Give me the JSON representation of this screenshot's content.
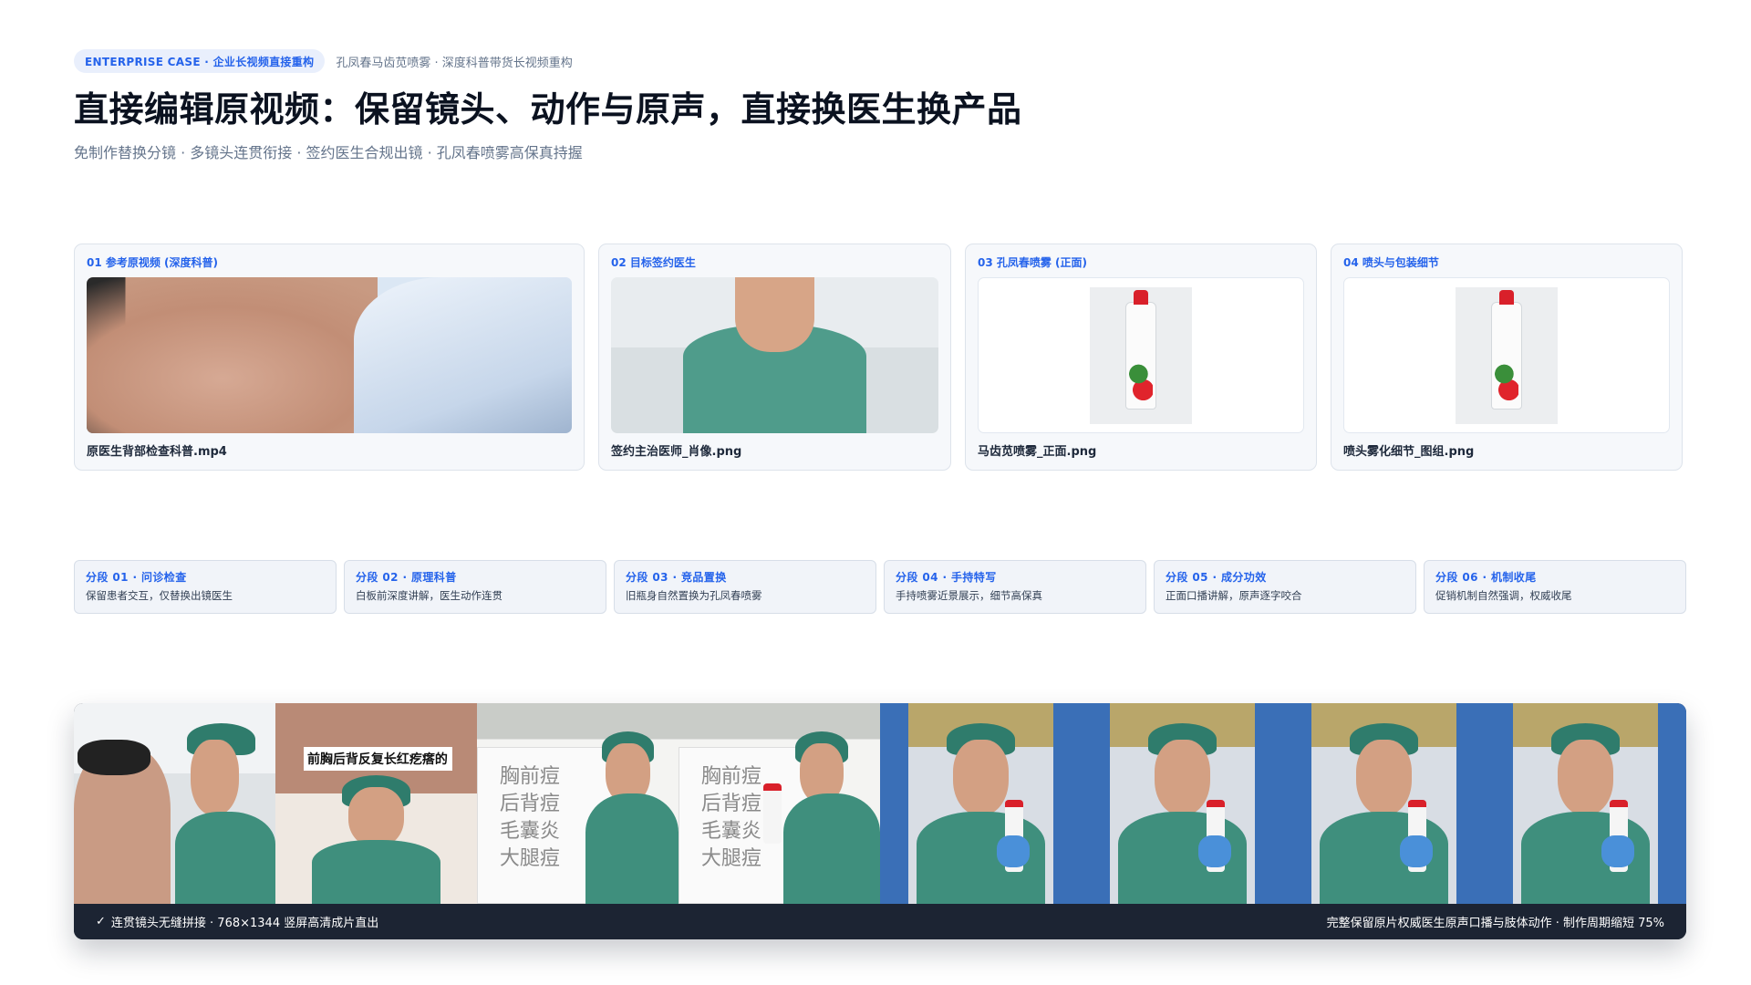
{
  "header": {
    "badge": "ENTERPRISE CASE · 企业长视频直接重构",
    "meta": "孔凤春马齿苋喷雾 · 深度科普带货长视频重构",
    "title": "直接编辑原视频：保留镜头、动作与原声，直接换医生换产品",
    "subtitle": "免制作替换分镜 · 多镜头连贯衔接 · 签约医生合规出镜 · 孔凤春喷雾高保真持握"
  },
  "assets": [
    {
      "label": "01 参考原视频 (深度科普)",
      "file": "原医生背部检查科普.mp4"
    },
    {
      "label": "02 目标签约医生",
      "file": "签约主治医师_肖像.png"
    },
    {
      "label": "03 孔凤春喷雾 (正面)",
      "file": "马齿苋喷雾_正面.png"
    },
    {
      "label": "04 喷头与包装细节",
      "file": "喷头雾化细节_图组.png"
    }
  ],
  "segments": [
    {
      "title": "分段 01 · 问诊检查",
      "desc": "保留患者交互，仅替换出镜医生"
    },
    {
      "title": "分段 02 · 原理科普",
      "desc": "白板前深度讲解，医生动作连贯"
    },
    {
      "title": "分段 03 · 竞品置换",
      "desc": "旧瓶身自然置换为孔凤春喷雾"
    },
    {
      "title": "分段 04 · 手持特写",
      "desc": "手持喷雾近景展示，细节高保真"
    },
    {
      "title": "分段 05 · 成分功效",
      "desc": "正面口播讲解，原声逐字咬合"
    },
    {
      "title": "分段 06 · 机制收尾",
      "desc": "促销机制自然强调，权威收尾"
    }
  ],
  "strip": {
    "frame2_caption": "前胸后背反复长红疙瘩的",
    "check_icon": "check-icon",
    "left_text": "连贯镜头无缝拼接 · 768×1344 竖屏高清成片直出",
    "right_text": "完整保留原片权威医生原声口播与肢体动作 · 制作周期缩短 75%"
  },
  "colors": {
    "accent": "#2563eb",
    "badge_bg": "#e9effc",
    "strip_bar": "#1c2433"
  }
}
